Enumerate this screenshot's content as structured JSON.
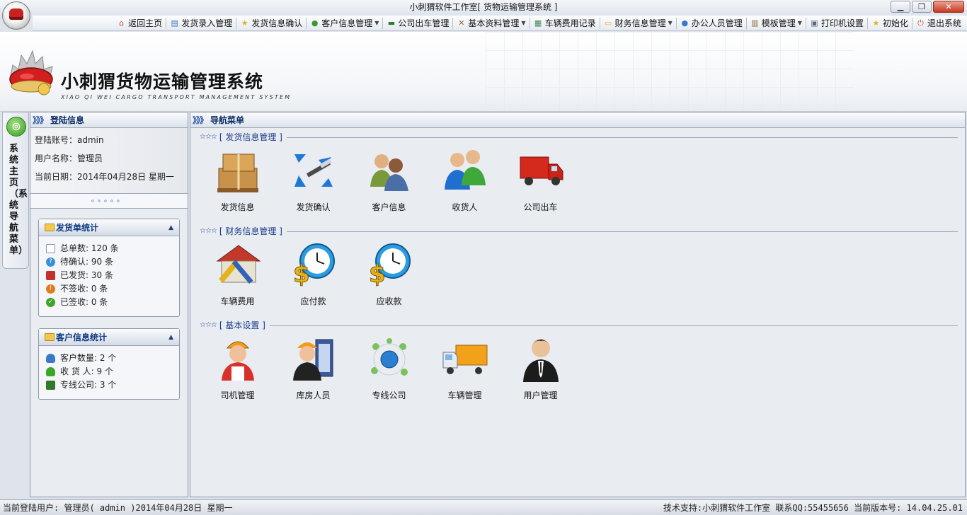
{
  "window": {
    "title": "小刺猬软件工作室[ 货物运输管理系统 ]",
    "buttons": [
      "▁",
      "❐",
      "✕"
    ]
  },
  "toolbar": {
    "items": [
      {
        "label": "返回主页",
        "icon": "home-icon",
        "color": "#c24a2a"
      },
      {
        "label": "发货录入管理",
        "icon": "form-icon",
        "color": "#3a6fc1"
      },
      {
        "label": "发货信息确认",
        "icon": "star-icon",
        "color": "#e2b21b"
      },
      {
        "label": "客户信息管理",
        "icon": "user-icon",
        "color": "#3c9a2d",
        "dropdown": true
      },
      {
        "label": "公司出车管理",
        "icon": "truck-icon",
        "color": "#2f7b2a"
      },
      {
        "label": "基本资料管理",
        "icon": "tools-icon",
        "color": "#8a6a3a",
        "dropdown": true
      },
      {
        "label": "车辆费用记录",
        "icon": "calendar-icon",
        "color": "#3c8a52"
      },
      {
        "label": "财务信息管理",
        "icon": "folder-icon",
        "color": "#e0b43b",
        "dropdown": true
      },
      {
        "label": "办公人员管理",
        "icon": "person-icon",
        "color": "#3a79c8"
      },
      {
        "label": "模板管理",
        "icon": "template-icon",
        "color": "#8a6a3a",
        "dropdown": true
      },
      {
        "label": "打印机设置",
        "icon": "printer-icon",
        "color": "#5a6b80"
      },
      {
        "label": "初始化",
        "icon": "star-icon",
        "color": "#e2b21b"
      },
      {
        "label": "退出系统",
        "icon": "exit-icon",
        "color": "#d4562b"
      }
    ]
  },
  "brand": {
    "title": "小刺猬货物运输管理系统",
    "subtitle": "XIAO QI WEI CARGO TRANSPORT MANAGEMENT SYSTEM"
  },
  "side_tab": {
    "label": "系统主页（系统导航菜单）"
  },
  "login_panel": {
    "header": "登陆信息",
    "account": "登陆账号：admin",
    "username": "用户名称：管理员",
    "date": "当前日期：2014年04月28日 星期一",
    "dots": "。。。。。"
  },
  "shipment_stats": {
    "header": "发货单统计",
    "rows": [
      {
        "text": "总单数: 120 条",
        "icon": "document-icon",
        "color": "#8a98ad"
      },
      {
        "text": "待确认: 90 条",
        "icon": "question-icon",
        "color": "#3a8fd8"
      },
      {
        "text": "已发货: 30 条",
        "icon": "truck-icon",
        "color": "#c2322a"
      },
      {
        "text": "不签收: 0 条",
        "icon": "info-icon",
        "color": "#e07b1f"
      },
      {
        "text": "已签收: 0 条",
        "icon": "check-icon",
        "color": "#3ca52c"
      }
    ]
  },
  "customer_stats": {
    "header": "客户信息统计",
    "rows": [
      {
        "text": "客户数量: 2 个",
        "icon": "user-icon",
        "color": "#3a79c8"
      },
      {
        "text": "收 货 人: 9 个",
        "icon": "user-icon",
        "color": "#3ca52c"
      },
      {
        "text": "专线公司: 3 个",
        "icon": "truck-icon",
        "color": "#2f7b2a"
      }
    ]
  },
  "nav_panel": {
    "header": "导航菜单",
    "sections": [
      {
        "title": "[ 发货信息管理 ]",
        "tiles": [
          {
            "label": "发货信息",
            "icon": "boxes-icon"
          },
          {
            "label": "发货确认",
            "icon": "sign-pen-icon"
          },
          {
            "label": "客户信息",
            "icon": "customers-icon"
          },
          {
            "label": "收货人",
            "icon": "receivers-icon"
          },
          {
            "label": "公司出车",
            "icon": "red-truck-icon"
          }
        ]
      },
      {
        "title": "[ 财务信息管理 ]",
        "tiles": [
          {
            "label": "车辆费用",
            "icon": "garage-tools-icon"
          },
          {
            "label": "应付款",
            "icon": "clock-dollar-icon"
          },
          {
            "label": "应收款",
            "icon": "clock-dollar-icon"
          }
        ]
      },
      {
        "title": "[ 基本设置 ]",
        "tiles": [
          {
            "label": "司机管理",
            "icon": "driver-icon"
          },
          {
            "label": "库房人员",
            "icon": "warehouse-worker-icon"
          },
          {
            "label": "专线公司",
            "icon": "network-icon"
          },
          {
            "label": "车辆管理",
            "icon": "yellow-truck-icon"
          },
          {
            "label": "用户管理",
            "icon": "businessman-icon"
          }
        ]
      }
    ]
  },
  "status_bar": {
    "left": "当前登陆用户: 管理员( admin )2014年04月28日 星期一",
    "right": "技术支持:小刺猬软件工作室 联系QQ:55455656 当前版本号: 14.04.25.01"
  }
}
